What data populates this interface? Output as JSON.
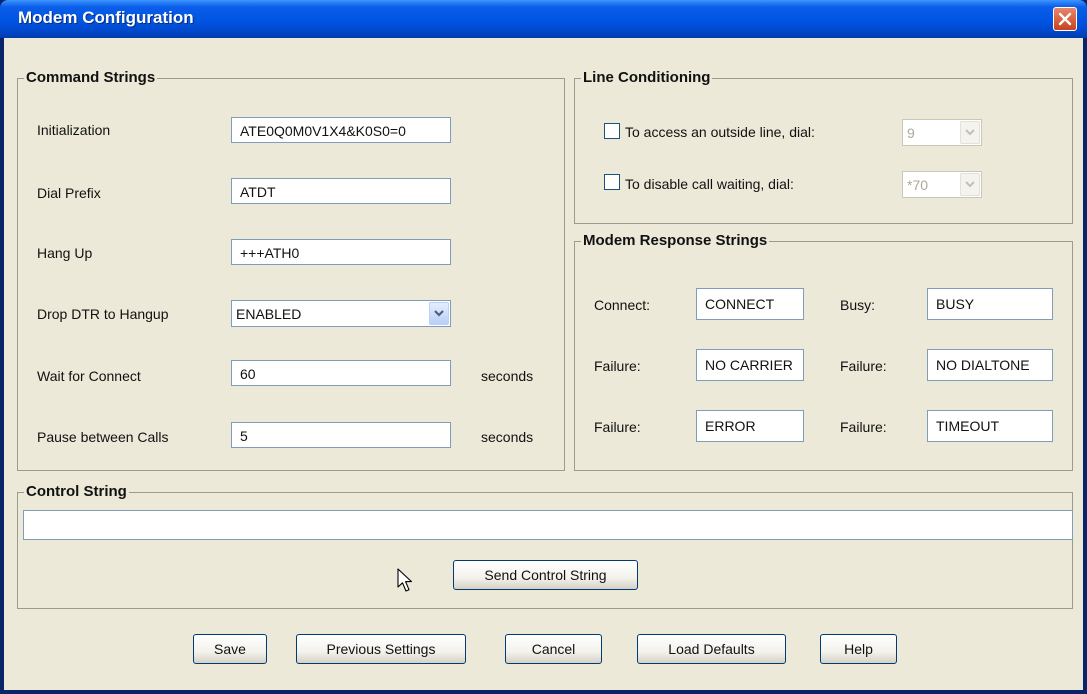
{
  "window": {
    "title": "Modem Configuration"
  },
  "command_strings": {
    "legend": "Command Strings",
    "initialization": {
      "label": "Initialization",
      "value": "ATE0Q0M0V1X4&K0S0=0"
    },
    "dial_prefix": {
      "label": "Dial Prefix",
      "value": "ATDT"
    },
    "hang_up": {
      "label": "Hang Up",
      "value": "+++ATH0"
    },
    "drop_dtr": {
      "label": "Drop DTR to Hangup",
      "value": "ENABLED"
    },
    "wait_for_connect": {
      "label": "Wait for Connect",
      "value": "60",
      "unit": "seconds"
    },
    "pause_between_calls": {
      "label": "Pause between Calls",
      "value": "5",
      "unit": "seconds"
    }
  },
  "line_conditioning": {
    "legend": "Line Conditioning",
    "outside_line": {
      "label": "To access an outside line, dial:",
      "checked": false,
      "value": "9"
    },
    "call_waiting": {
      "label": "To disable call waiting, dial:",
      "checked": false,
      "value": "*70"
    }
  },
  "response_strings": {
    "legend": "Modem Response Strings",
    "connect": {
      "label": "Connect:",
      "value": "CONNECT"
    },
    "busy": {
      "label": "Busy:",
      "value": "BUSY"
    },
    "failure1": {
      "label": "Failure:",
      "value": "NO CARRIER"
    },
    "failure2": {
      "label": "Failure:",
      "value": "NO DIALTONE"
    },
    "failure3": {
      "label": "Failure:",
      "value": "ERROR"
    },
    "failure4": {
      "label": "Failure:",
      "value": "TIMEOUT"
    }
  },
  "control_string": {
    "legend": "Control String",
    "value": "",
    "send_label": "Send Control String"
  },
  "buttons": {
    "save": "Save",
    "previous_settings": "Previous Settings",
    "cancel": "Cancel",
    "load_defaults": "Load Defaults",
    "help": "Help"
  },
  "icons": {
    "close": "close-icon",
    "dropdown": "chevron-down-icon",
    "cursor": "mouse-pointer-icon"
  },
  "colors": {
    "titlebar": "#0054e3",
    "dialog_bg": "#ece9d8",
    "close_button": "#c9411e"
  }
}
